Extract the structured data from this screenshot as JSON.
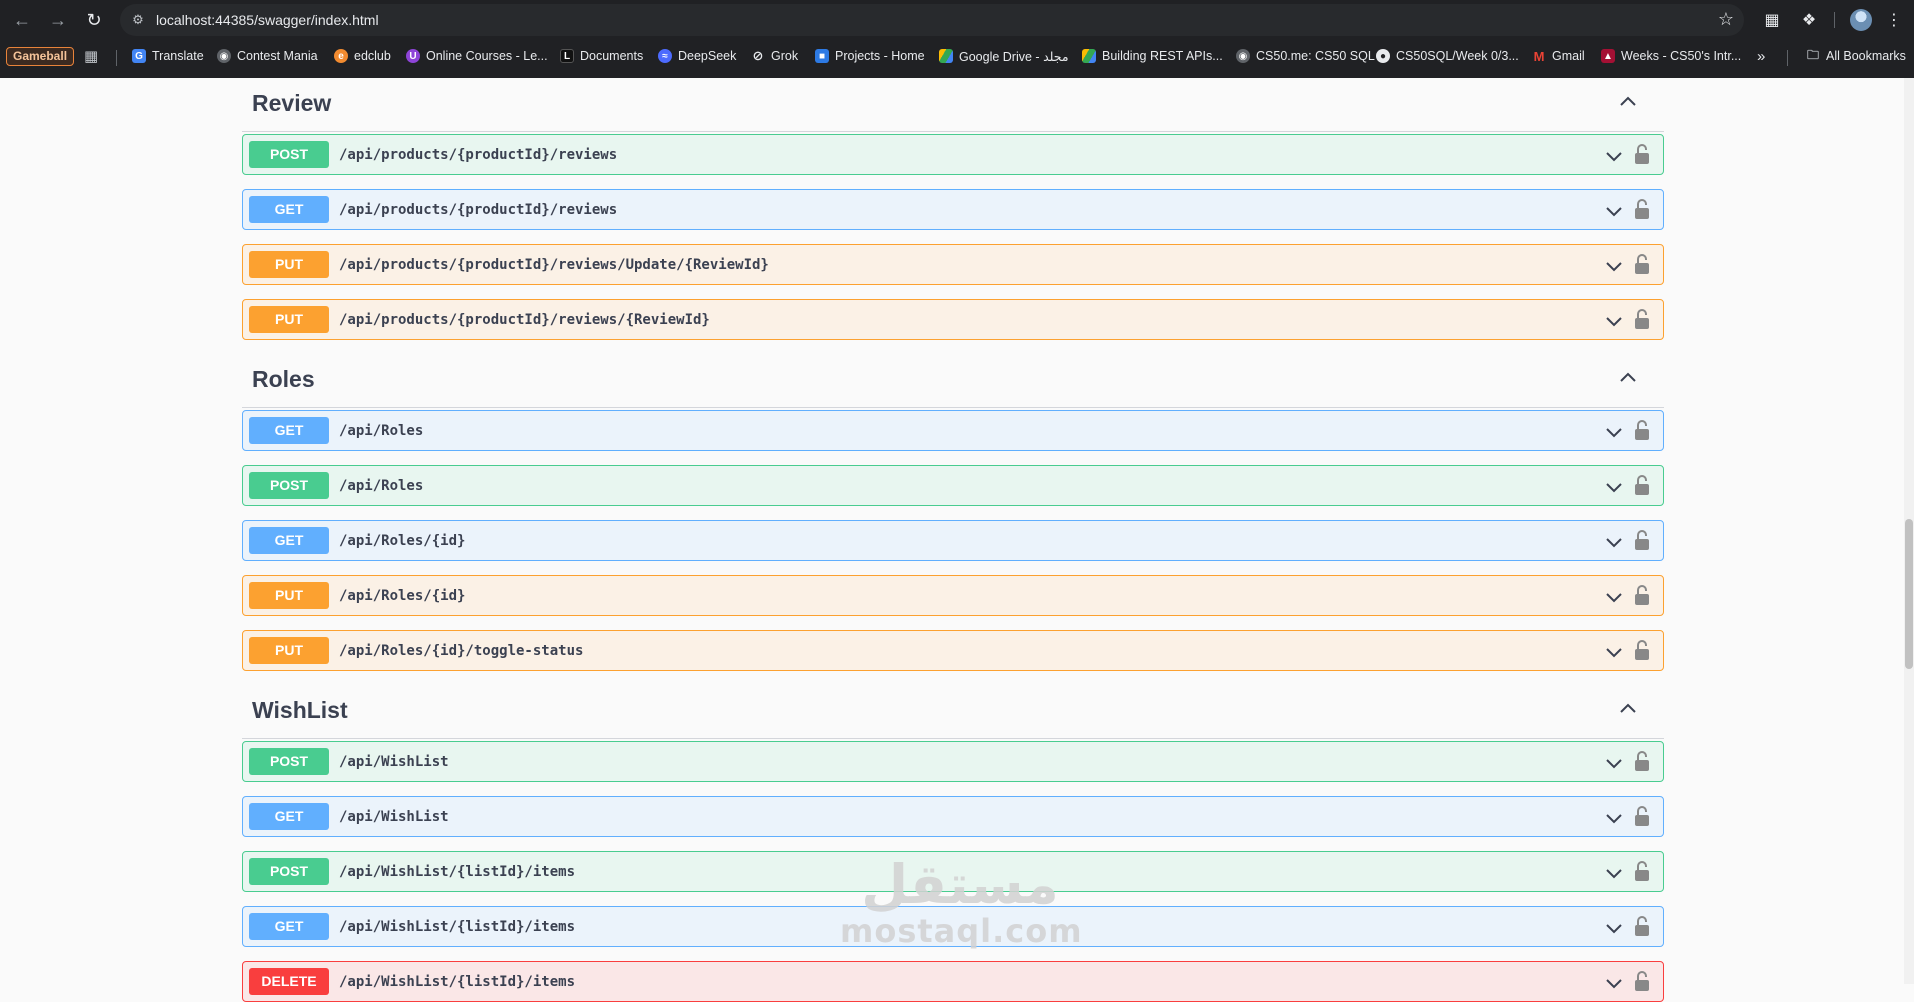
{
  "browser": {
    "url": "localhost:44385/swagger/index.html",
    "bookmarks": [
      {
        "label": "Gameball",
        "icon": "gameball-badge"
      },
      {
        "label": "Translate",
        "icon": "translate-icon",
        "color": "#4285f4"
      },
      {
        "label": "Contest Mania",
        "icon": "globe-icon",
        "color": "#9aa0a6"
      },
      {
        "label": "edclub",
        "icon": "edclub-icon",
        "color": "#f28b30"
      },
      {
        "label": "Online Courses - Le...",
        "icon": "courses-icon",
        "color": "#8e44d8"
      },
      {
        "label": "Documents",
        "icon": "documents-icon",
        "color": "#111111"
      },
      {
        "label": "DeepSeek",
        "icon": "deepseek-icon",
        "color": "#4d6bfe"
      },
      {
        "label": "Grok",
        "icon": "grok-icon",
        "color": "#e8eaed"
      },
      {
        "label": "Projects - Home",
        "icon": "azure-devops-icon",
        "color": "#2d7ae4"
      },
      {
        "label": "Google Drive - مجلد",
        "icon": "google-drive-icon",
        "color": "#34a853"
      },
      {
        "label": "Building REST APIs...",
        "icon": "google-drive-icon",
        "color": "#34a853"
      },
      {
        "label": "CS50.me: CS50 SQL",
        "icon": "globe-icon",
        "color": "#9aa0a6"
      },
      {
        "label": "CS50SQL/Week 0/3...",
        "icon": "github-icon",
        "color": "#e8eaed"
      },
      {
        "label": "Gmail",
        "icon": "gmail-icon",
        "color": "#ea4335"
      },
      {
        "label": "Weeks - CS50's Intr...",
        "icon": "harvard-icon",
        "color": "#a41034"
      }
    ],
    "all_bookmarks": "All Bookmarks"
  },
  "sections": [
    {
      "name": "Review",
      "operations": [
        {
          "method": "POST",
          "path": "/api/products/{productId}/reviews"
        },
        {
          "method": "GET",
          "path": "/api/products/{productId}/reviews"
        },
        {
          "method": "PUT",
          "path": "/api/products/{productId}/reviews/Update/{ReviewId}"
        },
        {
          "method": "PUT",
          "path": "/api/products/{productId}/reviews/{ReviewId}"
        }
      ]
    },
    {
      "name": "Roles",
      "operations": [
        {
          "method": "GET",
          "path": "/api/Roles"
        },
        {
          "method": "POST",
          "path": "/api/Roles"
        },
        {
          "method": "GET",
          "path": "/api/Roles/{id}"
        },
        {
          "method": "PUT",
          "path": "/api/Roles/{id}"
        },
        {
          "method": "PUT",
          "path": "/api/Roles/{id}/toggle-status"
        }
      ]
    },
    {
      "name": "WishList",
      "operations": [
        {
          "method": "POST",
          "path": "/api/WishList"
        },
        {
          "method": "GET",
          "path": "/api/WishList"
        },
        {
          "method": "POST",
          "path": "/api/WishList/{listId}/items"
        },
        {
          "method": "GET",
          "path": "/api/WishList/{listId}/items"
        },
        {
          "method": "DELETE",
          "path": "/api/WishList/{listId}/items"
        }
      ]
    }
  ],
  "watermark": {
    "logo": "مستقل",
    "domain": "mostaql.com"
  },
  "colors": {
    "post": "#49cc90",
    "get": "#61affe",
    "put": "#fca130",
    "delete": "#f93e3e"
  }
}
